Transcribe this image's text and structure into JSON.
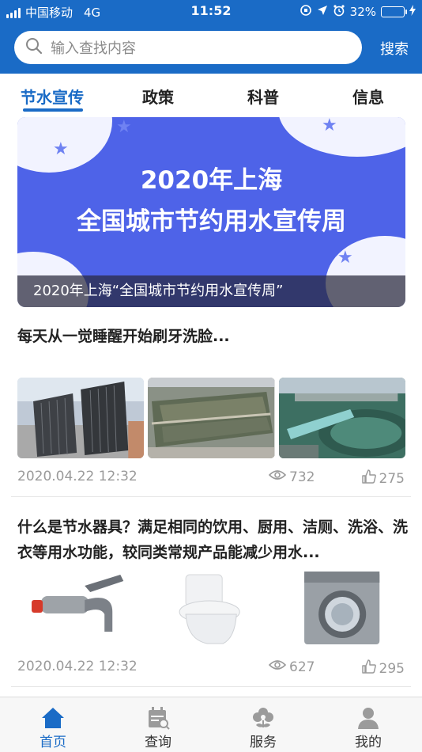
{
  "status_bar": {
    "carrier": "中国移动",
    "network": "4G",
    "time": "11:52",
    "battery": "32%",
    "battery_level": 0.32
  },
  "search": {
    "placeholder": "输入查找内容",
    "button_label": "搜索"
  },
  "tabs": [
    {
      "label": "节水宣传",
      "active": true
    },
    {
      "label": "政策",
      "active": false
    },
    {
      "label": "科普",
      "active": false
    },
    {
      "label": "信息",
      "active": false
    }
  ],
  "banner": {
    "line1": "2020年上海",
    "line2": "全国城市节约用水宣传周",
    "caption": "2020年上海“全国城市节约用水宣传周”"
  },
  "articles": [
    {
      "title": "每天从一觉睡醒开始刷牙洗脸...",
      "date": "2020.04.22 12:32",
      "views": "732",
      "likes": "275"
    },
    {
      "title": "什么是节水器具？满足相同的饮用、厨用、洁厕、洗浴、洗衣等用水功能，较同类常规产品能减少用水...",
      "date": "2020.04.22 12:32",
      "views": "627",
      "likes": "295"
    }
  ],
  "bottom_nav": [
    {
      "label": "首页",
      "icon": "home-icon",
      "active": true
    },
    {
      "label": "查询",
      "icon": "calendar-search-icon",
      "active": false
    },
    {
      "label": "服务",
      "icon": "flower-icon",
      "active": false
    },
    {
      "label": "我的",
      "icon": "user-icon",
      "active": false
    }
  ],
  "colors": {
    "brand": "#1a6bc6",
    "banner_bg": "#4e63e8",
    "meta_text": "#9a9a9a",
    "inactive_nav": "#9b9b9b"
  }
}
